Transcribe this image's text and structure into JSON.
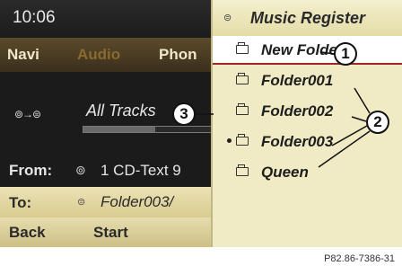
{
  "status": {
    "time": "10:06"
  },
  "menu": {
    "items": [
      "Navi",
      "Audio",
      "Phon"
    ]
  },
  "player": {
    "source_icon": "cd-to-hdd-icon",
    "track_text": "All Tracks",
    "progress_fraction": 0.5
  },
  "copy": {
    "from_label": "From:",
    "from_value": "1 CD-Text 9",
    "to_label": "To:",
    "to_value": "Folder003/"
  },
  "bottom": {
    "back_label": "Back",
    "start_label": "Start"
  },
  "music_register": {
    "title": "Music Register",
    "items": [
      {
        "label": "New Folder",
        "selected": true
      },
      {
        "label": "Folder001",
        "selected": false
      },
      {
        "label": "Folder002",
        "selected": false
      },
      {
        "label": "Folder003",
        "selected": false,
        "current": true
      },
      {
        "label": "Queen",
        "selected": false
      }
    ]
  },
  "callouts": [
    "1",
    "2",
    "3"
  ],
  "caption": "P82.86-7386-31",
  "colors": {
    "accent": "#9a2a24",
    "panel": "#f0ebc4",
    "menu_active": "#8a6a2e"
  }
}
